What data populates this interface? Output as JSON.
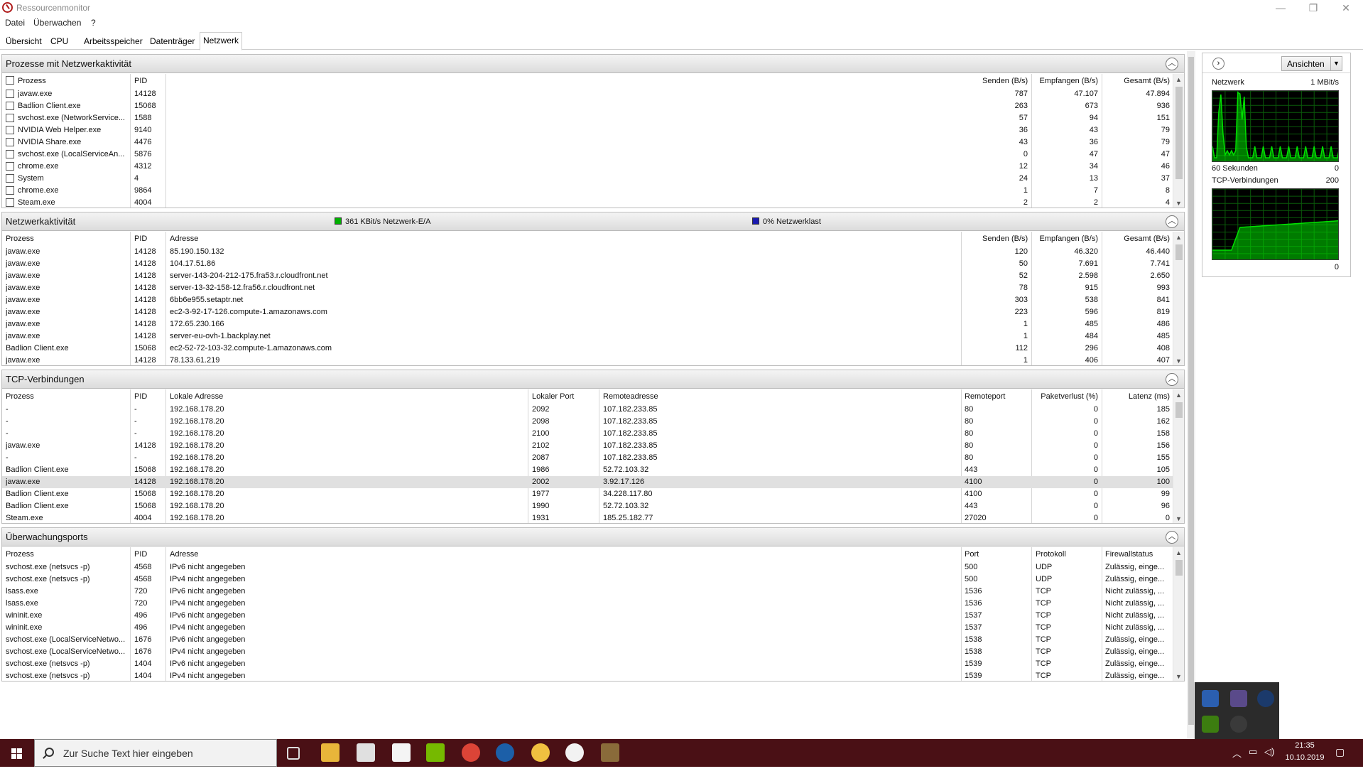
{
  "window": {
    "title": "Ressourcenmonitor",
    "minimize_icon": "—",
    "restore_icon": "❐",
    "close_icon": "✕"
  },
  "menu": [
    "Datei",
    "Überwachen",
    "?"
  ],
  "tabs": [
    "Übersicht",
    "CPU",
    "Arbeitsspeicher",
    "Datenträger",
    "Netzwerk"
  ],
  "active_tab": "Netzwerk",
  "processes": {
    "title": "Prozesse mit Netzwerkaktivität",
    "columns": [
      "Prozess",
      "PID",
      "Senden (B/s)",
      "Empfangen (B/s)",
      "Gesamt (B/s)"
    ],
    "rows": [
      [
        "javaw.exe",
        "14128",
        "787",
        "47.107",
        "47.894"
      ],
      [
        "Badlion Client.exe",
        "15068",
        "263",
        "673",
        "936"
      ],
      [
        "svchost.exe (NetworkService...",
        "1588",
        "57",
        "94",
        "151"
      ],
      [
        "NVIDIA Web Helper.exe",
        "9140",
        "36",
        "43",
        "79"
      ],
      [
        "NVIDIA Share.exe",
        "4476",
        "43",
        "36",
        "79"
      ],
      [
        "svchost.exe (LocalServiceAn...",
        "5876",
        "0",
        "47",
        "47"
      ],
      [
        "chrome.exe",
        "4312",
        "12",
        "34",
        "46"
      ],
      [
        "System",
        "4",
        "24",
        "13",
        "37"
      ],
      [
        "chrome.exe",
        "9864",
        "1",
        "7",
        "8"
      ],
      [
        "Steam.exe",
        "4004",
        "2",
        "2",
        "4"
      ]
    ]
  },
  "activity": {
    "title": "Netzwerkaktivität",
    "legend_io": "361 KBit/s Netzwerk-E/A",
    "legend_load": "0% Netzwerklast",
    "io_color": "#00b000",
    "load_color": "#1a1ab0",
    "columns": [
      "Prozess",
      "PID",
      "Adresse",
      "Senden (B/s)",
      "Empfangen (B/s)",
      "Gesamt (B/s)"
    ],
    "rows": [
      [
        "javaw.exe",
        "14128",
        "85.190.150.132",
        "120",
        "46.320",
        "46.440"
      ],
      [
        "javaw.exe",
        "14128",
        "104.17.51.86",
        "50",
        "7.691",
        "7.741"
      ],
      [
        "javaw.exe",
        "14128",
        "server-143-204-212-175.fra53.r.cloudfront.net",
        "52",
        "2.598",
        "2.650"
      ],
      [
        "javaw.exe",
        "14128",
        "server-13-32-158-12.fra56.r.cloudfront.net",
        "78",
        "915",
        "993"
      ],
      [
        "javaw.exe",
        "14128",
        "6bb6e955.setaptr.net",
        "303",
        "538",
        "841"
      ],
      [
        "javaw.exe",
        "14128",
        "ec2-3-92-17-126.compute-1.amazonaws.com",
        "223",
        "596",
        "819"
      ],
      [
        "javaw.exe",
        "14128",
        "172.65.230.166",
        "1",
        "485",
        "486"
      ],
      [
        "javaw.exe",
        "14128",
        "server-eu-ovh-1.backplay.net",
        "1",
        "484",
        "485"
      ],
      [
        "Badlion Client.exe",
        "15068",
        "ec2-52-72-103-32.compute-1.amazonaws.com",
        "112",
        "296",
        "408"
      ],
      [
        "javaw.exe",
        "14128",
        "78.133.61.219",
        "1",
        "406",
        "407"
      ]
    ]
  },
  "tcp": {
    "title": "TCP-Verbindungen",
    "columns": [
      "Prozess",
      "PID",
      "Lokale Adresse",
      "Lokaler Port",
      "Remoteadresse",
      "Remoteport",
      "Paketverlust (%)",
      "Latenz (ms)"
    ],
    "rows": [
      [
        "-",
        "-",
        "192.168.178.20",
        "2092",
        "107.182.233.85",
        "80",
        "0",
        "185"
      ],
      [
        "-",
        "-",
        "192.168.178.20",
        "2098",
        "107.182.233.85",
        "80",
        "0",
        "162"
      ],
      [
        "-",
        "-",
        "192.168.178.20",
        "2100",
        "107.182.233.85",
        "80",
        "0",
        "158"
      ],
      [
        "javaw.exe",
        "14128",
        "192.168.178.20",
        "2102",
        "107.182.233.85",
        "80",
        "0",
        "156"
      ],
      [
        "-",
        "-",
        "192.168.178.20",
        "2087",
        "107.182.233.85",
        "80",
        "0",
        "155"
      ],
      [
        "Badlion Client.exe",
        "15068",
        "192.168.178.20",
        "1986",
        "52.72.103.32",
        "443",
        "0",
        "105"
      ],
      [
        "javaw.exe",
        "14128",
        "192.168.178.20",
        "2002",
        "3.92.17.126",
        "4100",
        "0",
        "100"
      ],
      [
        "Badlion Client.exe",
        "15068",
        "192.168.178.20",
        "1977",
        "34.228.117.80",
        "4100",
        "0",
        "99"
      ],
      [
        "Badlion Client.exe",
        "15068",
        "192.168.178.20",
        "1990",
        "52.72.103.32",
        "443",
        "0",
        "96"
      ],
      [
        "Steam.exe",
        "4004",
        "192.168.178.20",
        "1931",
        "185.25.182.77",
        "27020",
        "0",
        "0"
      ]
    ],
    "selected_row": 6
  },
  "ports": {
    "title": "Überwachungsports",
    "columns": [
      "Prozess",
      "PID",
      "Adresse",
      "Port",
      "Protokoll",
      "Firewallstatus"
    ],
    "rows": [
      [
        "svchost.exe (netsvcs -p)",
        "4568",
        "IPv6 nicht angegeben",
        "500",
        "UDP",
        "Zulässig, einge..."
      ],
      [
        "svchost.exe (netsvcs -p)",
        "4568",
        "IPv4 nicht angegeben",
        "500",
        "UDP",
        "Zulässig, einge..."
      ],
      [
        "lsass.exe",
        "720",
        "IPv6 nicht angegeben",
        "1536",
        "TCP",
        "Nicht zulässig, ..."
      ],
      [
        "lsass.exe",
        "720",
        "IPv4 nicht angegeben",
        "1536",
        "TCP",
        "Nicht zulässig, ..."
      ],
      [
        "wininit.exe",
        "496",
        "IPv6 nicht angegeben",
        "1537",
        "TCP",
        "Nicht zulässig, ..."
      ],
      [
        "wininit.exe",
        "496",
        "IPv4 nicht angegeben",
        "1537",
        "TCP",
        "Nicht zulässig, ..."
      ],
      [
        "svchost.exe (LocalServiceNetwo...",
        "1676",
        "IPv6 nicht angegeben",
        "1538",
        "TCP",
        "Zulässig, einge..."
      ],
      [
        "svchost.exe (LocalServiceNetwo...",
        "1676",
        "IPv4 nicht angegeben",
        "1538",
        "TCP",
        "Zulässig, einge..."
      ],
      [
        "svchost.exe (netsvcs -p)",
        "1404",
        "IPv6 nicht angegeben",
        "1539",
        "TCP",
        "Zulässig, einge..."
      ],
      [
        "svchost.exe (netsvcs -p)",
        "1404",
        "IPv4 nicht angegeben",
        "1539",
        "TCP",
        "Zulässig, einge..."
      ]
    ]
  },
  "right_panel": {
    "views_label": "Ansichten",
    "net_graph": {
      "label": "Netzwerk",
      "scale": "1 MBit/s",
      "time_label": "60 Sekunden",
      "min": "0",
      "line_color": "#00e000"
    },
    "tcp_graph": {
      "label": "TCP-Verbindungen",
      "scale": "200",
      "min": "0",
      "line_color": "#00e000"
    }
  },
  "taskbar": {
    "search_placeholder": "Zur Suche Text hier eingeben",
    "time": "21:35",
    "date": "10.10.2019",
    "bg_color": "#4a1015"
  }
}
